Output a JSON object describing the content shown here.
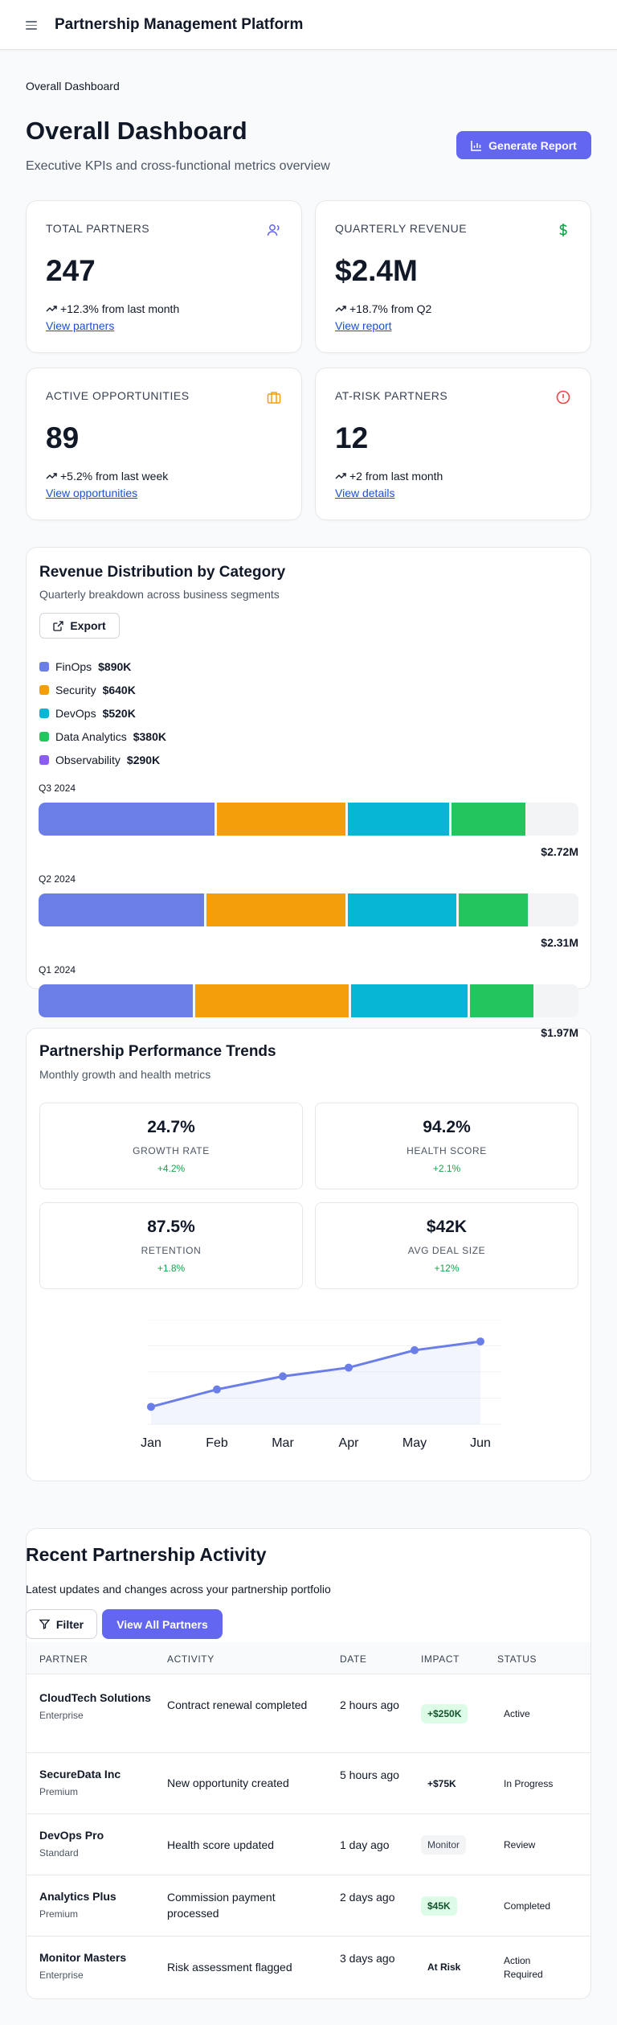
{
  "app": {
    "title": "Partnership Management Platform"
  },
  "breadcrumb": "Overall Dashboard",
  "header": {
    "title": "Overall Dashboard",
    "subtitle": "Executive KPIs and cross-functional metrics overview",
    "generate_label": "Generate Report"
  },
  "kpis": [
    {
      "label": "TOTAL PARTNERS",
      "value": "247",
      "change": "+12.3% from last month",
      "link": "View partners",
      "icon": "users-icon",
      "icon_color": "#6366f1"
    },
    {
      "label": "QUARTERLY REVENUE",
      "value": "$2.4M",
      "change": "+18.7% from Q2",
      "link": "View report",
      "icon": "dollar-icon",
      "icon_color": "#16a34a"
    },
    {
      "label": "ACTIVE OPPORTUNITIES",
      "value": "89",
      "change": "+5.2% from last week",
      "link": "View opportunities",
      "icon": "briefcase-icon",
      "icon_color": "#f59e0b"
    },
    {
      "label": "AT-RISK PARTNERS",
      "value": "12",
      "change": "+2 from last month",
      "link": "View details",
      "icon": "alert-circle-icon",
      "icon_color": "#ef4444"
    }
  ],
  "revenue": {
    "title": "Revenue Distribution by Category",
    "subtitle": "Quarterly breakdown across business segments",
    "export_label": "Export",
    "legend": [
      {
        "name": "FinOps",
        "amount": "$890K",
        "color": "#6b7ee8"
      },
      {
        "name": "Security",
        "amount": "$640K",
        "color": "#f59e0b"
      },
      {
        "name": "DevOps",
        "amount": "$520K",
        "color": "#06b6d4"
      },
      {
        "name": "Data Analytics",
        "amount": "$380K",
        "color": "#22c55e"
      },
      {
        "name": "Observability",
        "amount": "$290K",
        "color": "#8b5cf6"
      }
    ],
    "quarters": [
      {
        "label": "Q3 2024",
        "total": "$2.72M",
        "segments": [
          0.33,
          0.242,
          0.192,
          0.142,
          0.094
        ]
      },
      {
        "label": "Q2 2024",
        "total": "$2.31M",
        "segments": [
          0.311,
          0.262,
          0.205,
          0.132,
          0.09
        ]
      },
      {
        "label": "Q1 2024",
        "total": "$1.97M",
        "segments": [
          0.29,
          0.289,
          0.22,
          0.122,
          0.079
        ]
      }
    ]
  },
  "performance": {
    "title": "Partnership Performance Trends",
    "subtitle": "Monthly growth and health metrics",
    "metrics": [
      {
        "value": "24.7%",
        "label": "GROWTH RATE",
        "change": "+4.2%"
      },
      {
        "value": "94.2%",
        "label": "HEALTH SCORE",
        "change": "+2.1%"
      },
      {
        "value": "87.5%",
        "label": "RETENTION",
        "change": "+1.8%"
      },
      {
        "value": "$42K",
        "label": "AVG DEAL SIZE",
        "change": "+12%"
      }
    ],
    "chart_data": {
      "type": "area",
      "x": [
        "Jan",
        "Feb",
        "Mar",
        "Apr",
        "May",
        "Jun"
      ],
      "y": [
        20,
        40,
        55,
        65,
        85,
        95
      ],
      "ylim": [
        0,
        120
      ],
      "grid": true,
      "color": "#6b7ee8"
    }
  },
  "activity": {
    "title": "Recent Partnership Activity",
    "subtitle": "Latest updates and changes across your partnership portfolio",
    "filter_label": "Filter",
    "view_all_label": "View All Partners",
    "columns": [
      "PARTNER",
      "ACTIVITY",
      "DATE",
      "IMPACT",
      "STATUS"
    ],
    "rows": [
      {
        "partner": "CloudTech Solutions",
        "tier": "Enterprise",
        "activity": "Contract renewal completed",
        "date": "2 hours ago",
        "impact": "+$250K",
        "impact_style": "green",
        "status": "Active"
      },
      {
        "partner": "SecureData Inc",
        "tier": "Premium",
        "activity": "New opportunity created",
        "date": "5 hours ago",
        "impact": "+$75K",
        "impact_style": "plain",
        "status": "In Progress"
      },
      {
        "partner": "DevOps Pro",
        "tier": "Standard",
        "activity": "Health score updated",
        "date": "1 day ago",
        "impact": "Monitor",
        "impact_style": "gray",
        "status": "Review"
      },
      {
        "partner": "Analytics Plus",
        "tier": "Premium",
        "activity": "Commission payment processed",
        "date": "2 days ago",
        "impact": "$45K",
        "impact_style": "green",
        "status": "Completed"
      },
      {
        "partner": "Monitor Masters",
        "tier": "Enterprise",
        "activity": "Risk assessment flagged",
        "date": "3 days ago",
        "impact": "At Risk",
        "impact_style": "plain",
        "status": "Action Required"
      }
    ]
  }
}
